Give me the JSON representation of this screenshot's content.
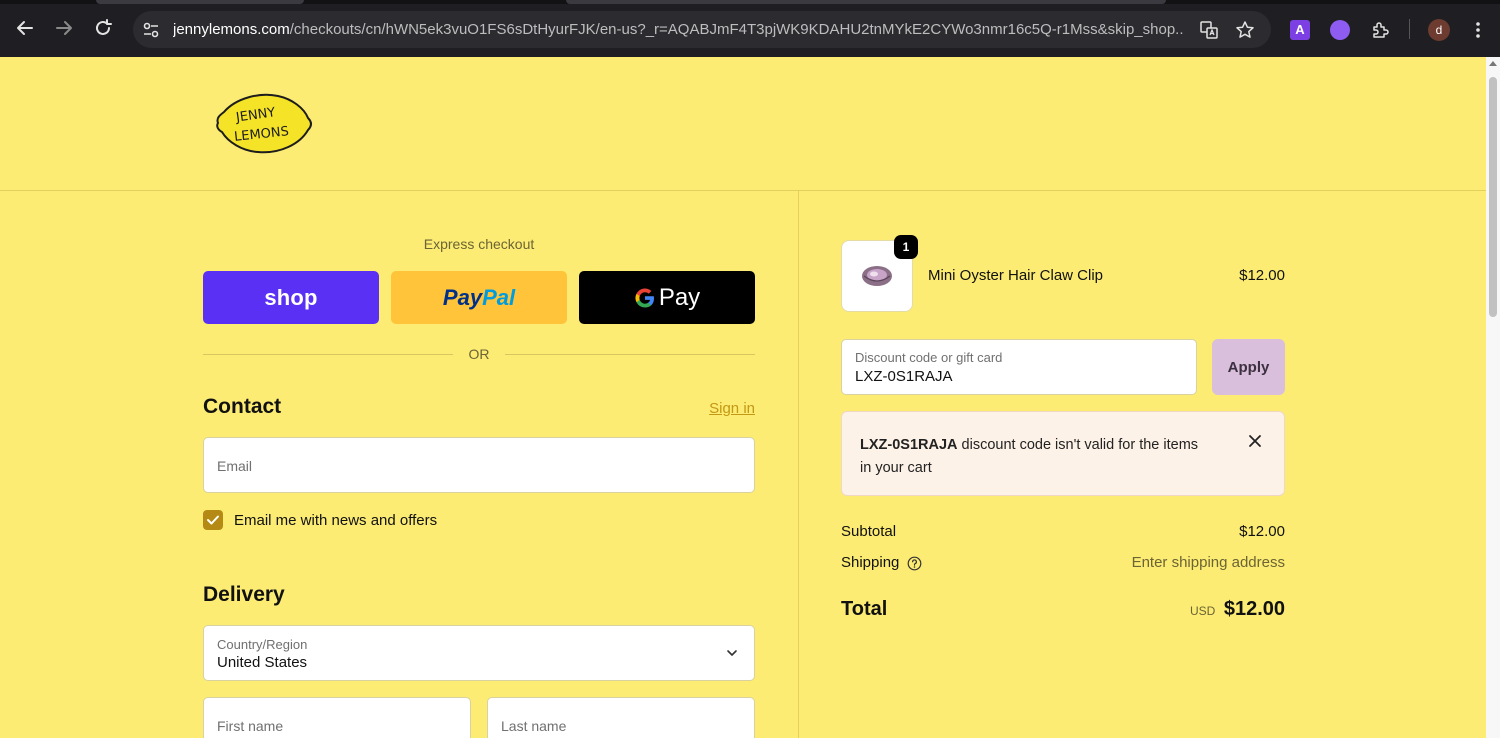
{
  "browser": {
    "url_domain": "jennylemons.com",
    "url_path": "/checkouts/cn/hWN5ek3vuO1FS6sDtHyurFJK/en-us?_r=AQABJmF4T3pjWK9KDAHU2tnMYkE2CYWo3nmr16c5Q-r1Mss&skip_shop...",
    "profile_initial": "d",
    "extension_a_label": "A"
  },
  "header": {
    "logo_text_line1": "JENNY",
    "logo_text_line2": "LEMONS"
  },
  "express": {
    "title": "Express checkout",
    "shop_label": "shop",
    "paypal_label_1": "Pay",
    "paypal_label_2": "Pal",
    "gpay_g": "G",
    "gpay_label": "Pay",
    "or_label": "OR"
  },
  "contact": {
    "title": "Contact",
    "signin_label": "Sign in",
    "email_placeholder": "Email",
    "newsletter_label": "Email me with news and offers",
    "newsletter_checked": true
  },
  "delivery": {
    "title": "Delivery",
    "country_label": "Country/Region",
    "country_value": "United States",
    "first_name_placeholder": "First name",
    "last_name_placeholder": "Last name"
  },
  "cart": {
    "item_name": "Mini Oyster Hair Claw Clip",
    "item_price": "$12.00",
    "item_qty": "1",
    "discount_label": "Discount code or gift card",
    "discount_value": "LXZ-0S1RAJA",
    "apply_label": "Apply",
    "error_code": "LXZ-0S1RAJA",
    "error_message_1": " discount code isn't valid for the items",
    "error_message_2": "in your cart",
    "subtotal_label": "Subtotal",
    "subtotal_value": "$12.00",
    "shipping_label": "Shipping",
    "shipping_value": "Enter shipping address",
    "total_label": "Total",
    "total_currency": "USD",
    "total_value": "$12.00"
  },
  "colors": {
    "page_bg": "#fcec74",
    "shop_pay": "#5a31f4",
    "paypal": "#ffc439",
    "gpay": "#000000",
    "checkbox": "#b58a14",
    "apply_button": "#d9bfdc",
    "error_bg": "#fdf2e8"
  }
}
